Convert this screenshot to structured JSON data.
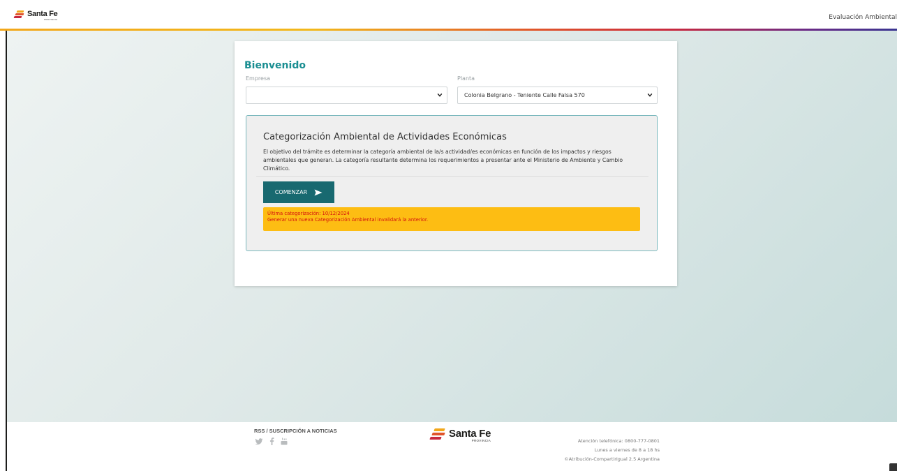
{
  "header": {
    "brand": "Santa Fe",
    "brand_sub": "PROVINCIA",
    "right_link": "Evaluación Ambiental"
  },
  "form": {
    "welcome": "Bienvenido",
    "empresa_label": "Empresa",
    "empresa_value": "",
    "planta_label": "Planta",
    "planta_value": "Colonia Belgrano - Teniente Calle Falsa 570"
  },
  "panel": {
    "title": "Categorización Ambiental de Actividades Económicas",
    "description": "El objetivo del trámite es determinar la categoría ambiental de la/s actividad/es económicas en función de los impactos y riesgos ambientales que generan. La categoría resultante determina los requerimientos a presentar ante el Ministerio de Ambiente y Cambio Climático.",
    "button_label": "COMENZAR",
    "alert_line1": "Última categorización: 10/12/2024",
    "alert_line2": "Generar una nueva Categorización Ambiental invalidará la anterior."
  },
  "footer": {
    "rss": "RSS / SUSCRIPCIÓN A NOTICIAS",
    "social": [
      "twitter-icon",
      "facebook-icon",
      "youtube-icon"
    ],
    "brand": "Santa Fe",
    "brand_sub": "PROVINCIA",
    "phone": "Atención telefónica: 0800-777-0801",
    "hours": "Lunes a viernes de 8 a 18 hs",
    "license": "©Atribución-CompartirIgual 2.5 Argentina"
  },
  "colors": {
    "accent": "#1a8e92",
    "button": "#186970",
    "alert_bg": "#fdbd13",
    "alert_text": "#d40f0f"
  }
}
